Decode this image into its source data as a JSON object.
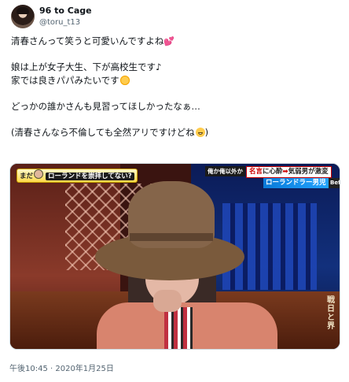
{
  "author": {
    "name": "96 to Cage",
    "handle": "@toru_t13"
  },
  "tweet": {
    "lines": [
      "清春さんって笑うと可愛いんですよね",
      "",
      "娘は上が女子大生、下が高校生です♪",
      "家では良きパパみたいです",
      "",
      "どっかの誰かさんも見習ってほしかったなぁ…",
      "",
      "(清春さんなら不倫しても全然アリですけどね",
      ")"
    ],
    "emojis": [
      "two-hearts-icon",
      "smiling-face-with-halo-icon",
      "grinning-face-icon"
    ]
  },
  "media": {
    "caption_left_prefix": "まだ",
    "caption_left_main": "ローランドを崇拝してない?",
    "caption_right_tag": "俺か俺以外か",
    "caption_right_brand": "名言",
    "caption_right_text1": "に心酔",
    "caption_right_arrow": "➡",
    "caption_right_text2": "気弱男が激変",
    "caption_right_band": "ローランドラー男児",
    "caption_right_corner": "Befo",
    "side_text": "戦 日 と 界"
  },
  "timestamp": "午後10:45 · 2020年1月25日"
}
